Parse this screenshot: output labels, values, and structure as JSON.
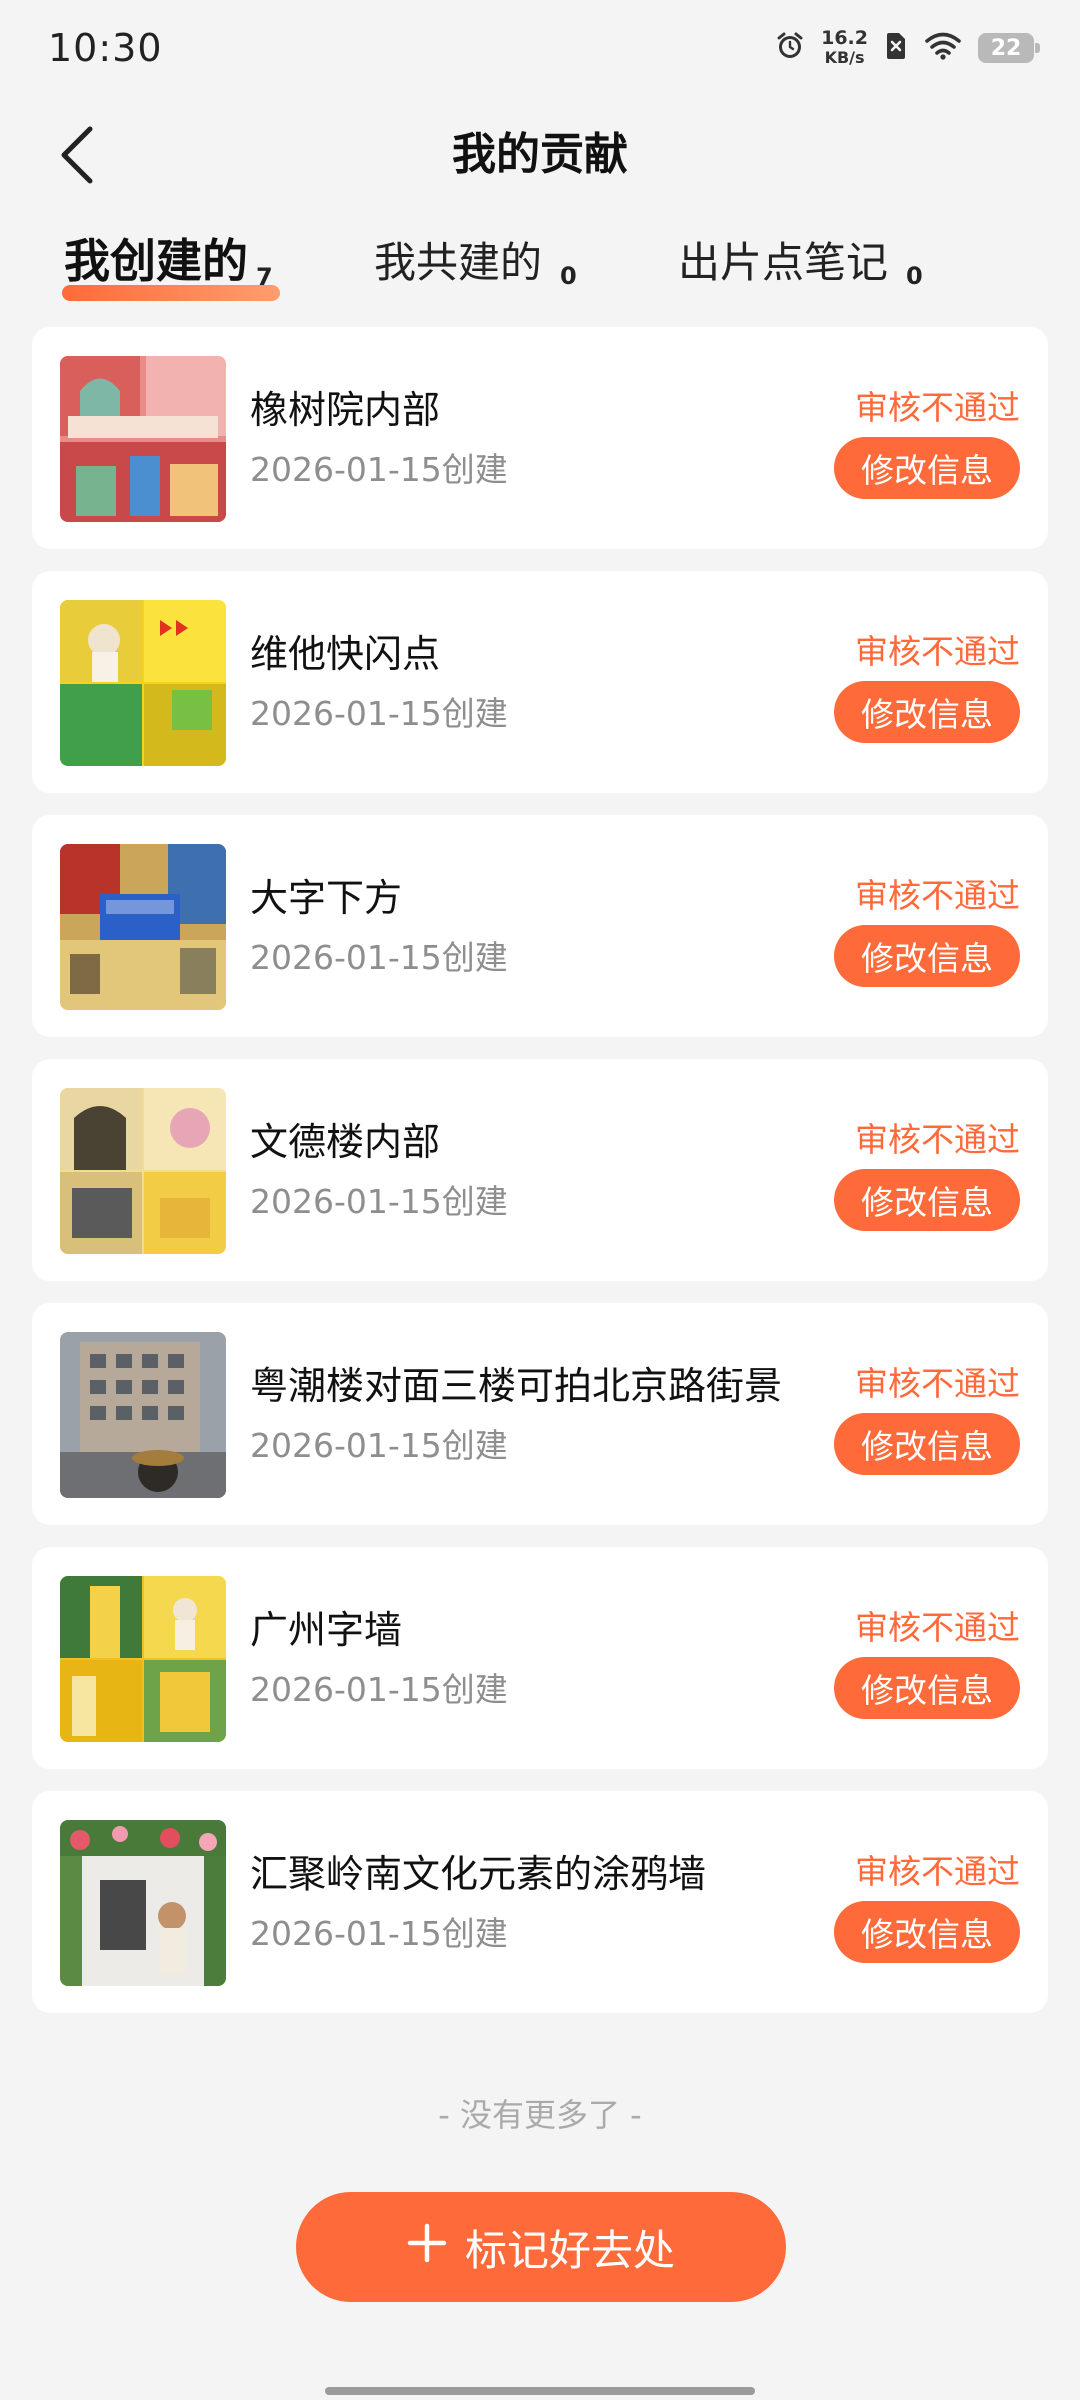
{
  "status_bar": {
    "time": "10:30",
    "net_speed_value": "16.2",
    "net_speed_unit": "KB/s",
    "battery": "22",
    "icons": [
      "alarm-icon",
      "sim-off-icon",
      "wifi-icon",
      "battery-icon"
    ]
  },
  "header": {
    "title": "我的贡献",
    "back_icon": "chevron-left-icon"
  },
  "tabs": [
    {
      "label": "我创建的",
      "count": "7",
      "active": true
    },
    {
      "label": "我共建的",
      "count": "0",
      "active": false
    },
    {
      "label": "出片点笔记",
      "count": "0",
      "active": false
    }
  ],
  "items": [
    {
      "title": "橡树院内部",
      "date": "2026-01-15创建",
      "status": "审核不通过",
      "button": "修改信息"
    },
    {
      "title": "维他快闪点",
      "date": "2026-01-15创建",
      "status": "审核不通过",
      "button": "修改信息"
    },
    {
      "title": "大字下方",
      "date": "2026-01-15创建",
      "status": "审核不通过",
      "button": "修改信息"
    },
    {
      "title": "文德楼内部",
      "date": "2026-01-15创建",
      "status": "审核不通过",
      "button": "修改信息"
    },
    {
      "title": "粤潮楼对面三楼可拍北京路街景",
      "date": "2026-01-15创建",
      "status": "审核不通过",
      "button": "修改信息"
    },
    {
      "title": "广州字墙",
      "date": "2026-01-15创建",
      "status": "审核不通过",
      "button": "修改信息"
    },
    {
      "title": "汇聚岭南文化元素的涂鸦墙",
      "date": "2026-01-15创建",
      "status": "审核不通过",
      "button": "修改信息"
    }
  ],
  "footer": {
    "no_more": "- 没有更多了 -",
    "add_button": "标记好去处"
  },
  "colors": {
    "accent": "#ff6a3a",
    "background": "#f4f4f5",
    "muted_text": "#8e8e8e"
  }
}
